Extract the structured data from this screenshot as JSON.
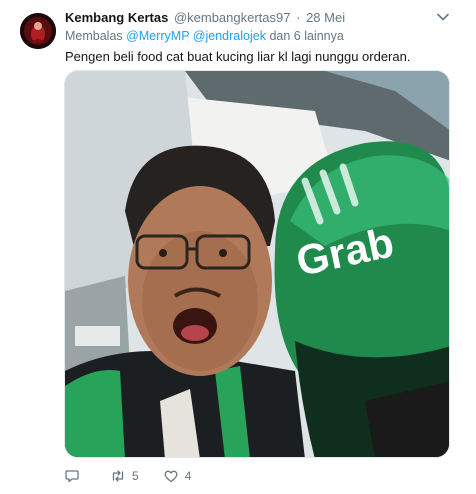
{
  "tweet": {
    "author_name": "Kembang Kertas",
    "author_handle": "@kembangkertas97",
    "separator": "·",
    "timestamp": "28 Mei",
    "reply_prefix": "Membalas",
    "reply_mention_1": "@MerryMP",
    "reply_mention_2": "@jendralojek",
    "reply_suffix": "dan 6 lainnya",
    "text": "Pengen beli food cat buat kucing liar kl lagi nunggu orderan.",
    "media_helmet_text": "Grab"
  },
  "actions": {
    "reply_count": "",
    "retweet_count": "5",
    "like_count": "4"
  },
  "icons": {
    "caret": "chevron-down-icon",
    "reply": "reply-icon",
    "retweet": "retweet-icon",
    "like": "heart-icon"
  },
  "colors": {
    "link": "#1da1f2",
    "muted": "#657786",
    "text": "#14171a",
    "brand_green": "#1f8a4c"
  }
}
